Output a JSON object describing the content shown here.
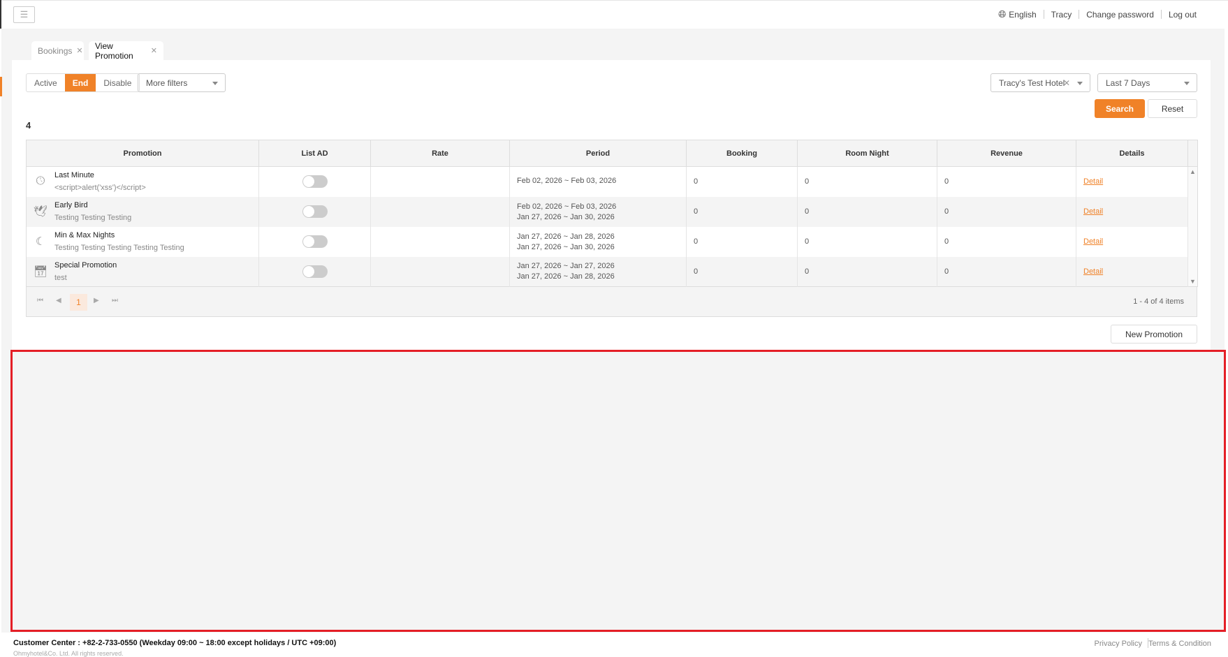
{
  "topbar": {
    "language": "English",
    "user": "Tracy",
    "change_password": "Change password",
    "logout": "Log out"
  },
  "tabs": [
    {
      "label": "Bookings"
    },
    {
      "label": "View Promotion"
    }
  ],
  "filters": {
    "status": [
      {
        "label": "Active"
      },
      {
        "label": "End"
      },
      {
        "label": "Disable"
      }
    ],
    "more_filters": "More filters",
    "hotel": "Tracy's Test Hotel",
    "date_range": "Last 7 Days",
    "search": "Search",
    "reset": "Reset"
  },
  "count": "4",
  "table": {
    "headers": [
      "Promotion",
      "List AD",
      "Rate",
      "Period",
      "Booking",
      "Room Night",
      "Revenue",
      "Details"
    ],
    "rows": [
      {
        "name": "Last Minute",
        "desc": "<script>alert('xss')</script>",
        "icon": "clock-icon",
        "period1": "Feb 02, 2026 ~ Feb 03, 2026",
        "period2": "",
        "booking": "0",
        "room_night": "0",
        "revenue": "0",
        "detail": "Detail"
      },
      {
        "name": "Early Bird",
        "desc": "Testing Testing Testing",
        "icon": "bird-icon",
        "period1": "Feb 02, 2026 ~ Feb 03, 2026",
        "period2": "Jan 27, 2026 ~ Jan 30, 2026",
        "booking": "0",
        "room_night": "0",
        "revenue": "0",
        "detail": "Detail"
      },
      {
        "name": "Min & Max Nights",
        "desc": "Testing Testing Testing Testing Testing",
        "icon": "moon-icon",
        "period1": "Jan 27, 2026 ~ Jan 28, 2026",
        "period2": "Jan 27, 2026 ~ Jan 30, 2026",
        "booking": "0",
        "room_night": "0",
        "revenue": "0",
        "detail": "Detail"
      },
      {
        "name": "Special Promotion",
        "desc": "test",
        "icon": "calendar-star-icon",
        "period1": "Jan 27, 2026 ~ Jan 27, 2026",
        "period2": "Jan 27, 2026 ~ Jan 28, 2026",
        "booking": "0",
        "room_night": "0",
        "revenue": "0",
        "detail": "Detail"
      }
    ]
  },
  "pager": {
    "page": "1",
    "summary": "1 - 4 of 4 items"
  },
  "new_promotion": "New Promotion",
  "footer": {
    "customer_center": "Customer Center : +82-2-733-0550 (Weekday 09:00 ~ 18:00 except holidays / UTC +09:00)",
    "copyright": "Ohmyhotel&Co. Ltd. All rights reserved.",
    "privacy": "Privacy Policy",
    "terms": "Terms & Condition"
  },
  "colors": {
    "accent": "#f08228",
    "highlight": "#e41e26"
  }
}
